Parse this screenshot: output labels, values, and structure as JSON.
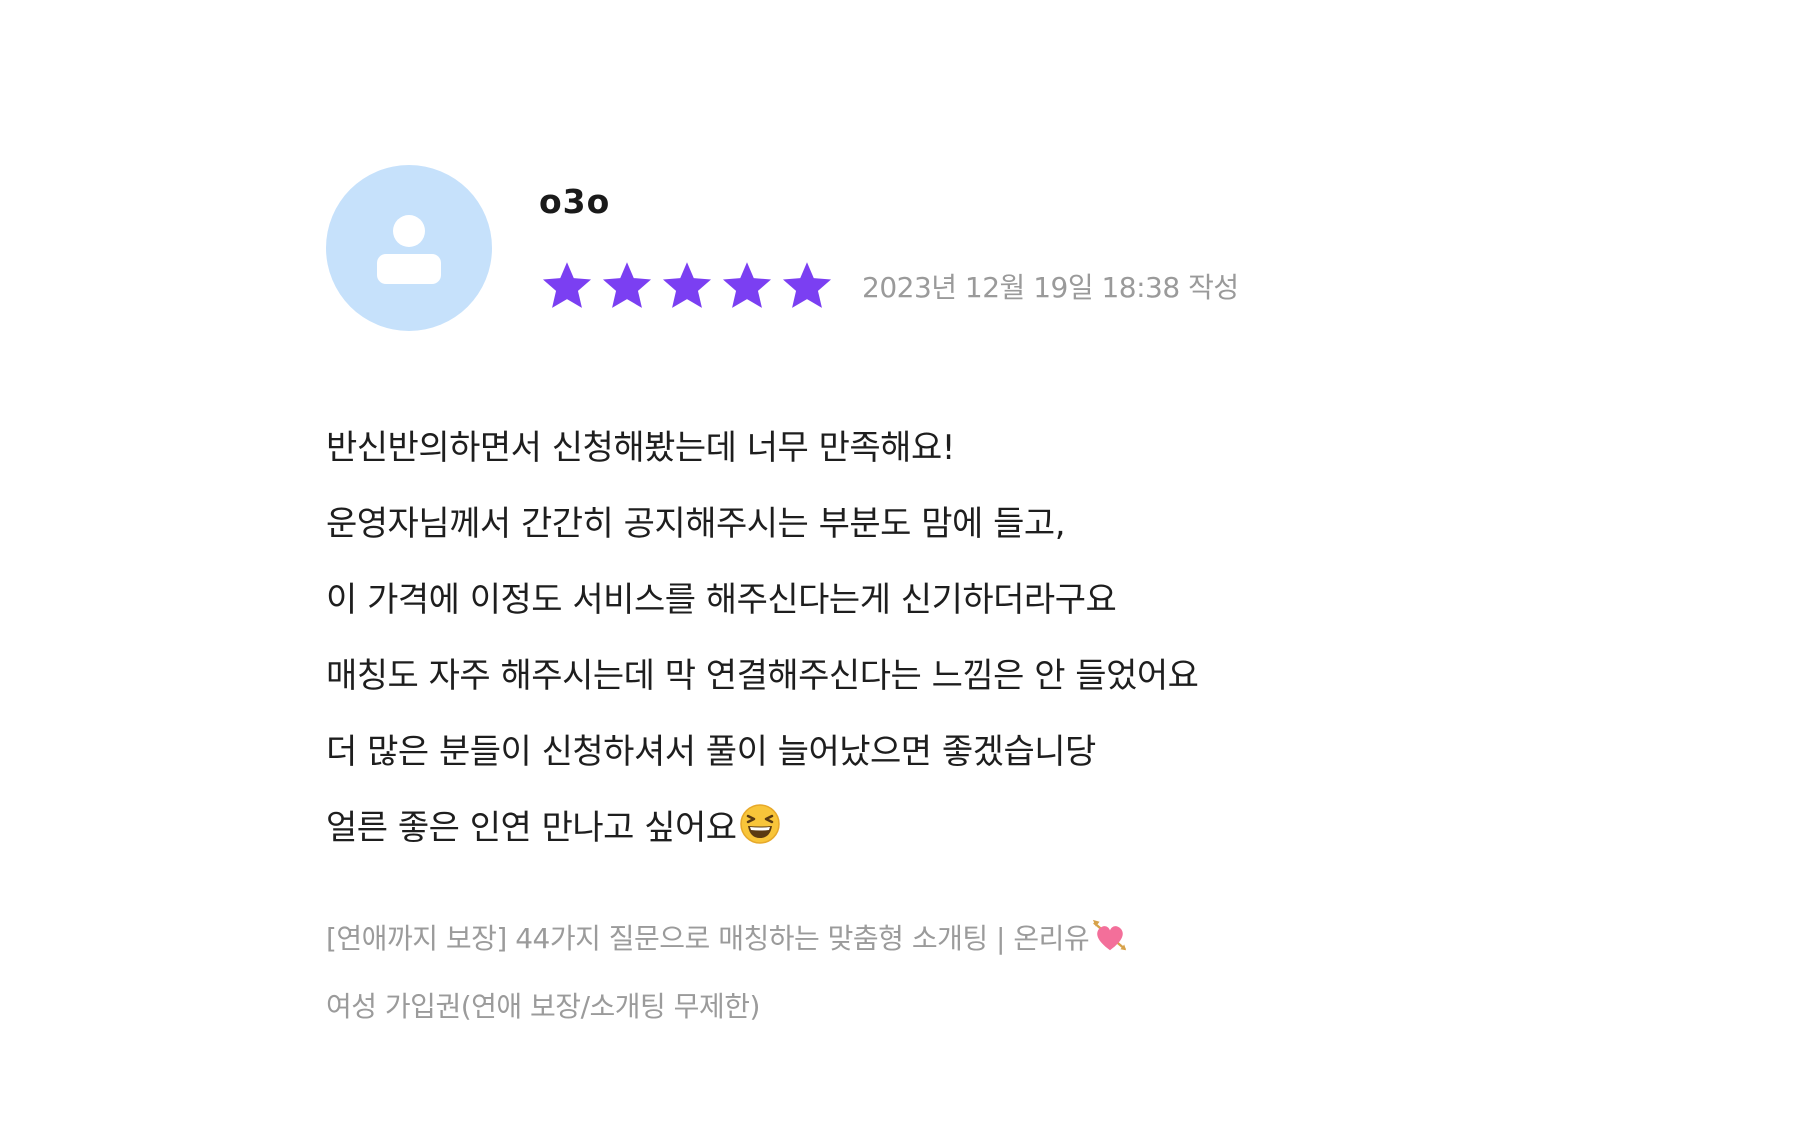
{
  "review": {
    "author": "o3o",
    "rating": 5,
    "rating_max": 5,
    "star_color": "#7b3ff2",
    "date": "2023년 12월 19일 18:38 작성",
    "body_lines": [
      "반신반의하면서 신청해봤는데 너무 만족해요!",
      "운영자님께서 간간히 공지해주시는 부분도 맘에 들고,",
      "이 가격에 이정도 서비스를 해주신다는게 신기하더라구요",
      "매칭도 자주 해주시는데 막 연결해주신다는 느낌은 안 들었어요",
      "더 많은 분들이 신청하셔서 풀이 늘어났으면 좋겠습니당",
      "얼른 좋은 인연 만나고 싶어요"
    ],
    "body_end_icon": "grinning-squinting-face-icon"
  },
  "product": {
    "title": "[연애까지 보장] 44가지 질문으로 매칭하는 맞춤형 소개팅 | 온리유",
    "title_end_icon": "heart-with-arrow-icon",
    "option": "여성 가입권(연애 보장/소개팅 무제한)"
  },
  "avatar": {
    "icon": "user-icon",
    "bg_color": "#c6e1fb"
  }
}
